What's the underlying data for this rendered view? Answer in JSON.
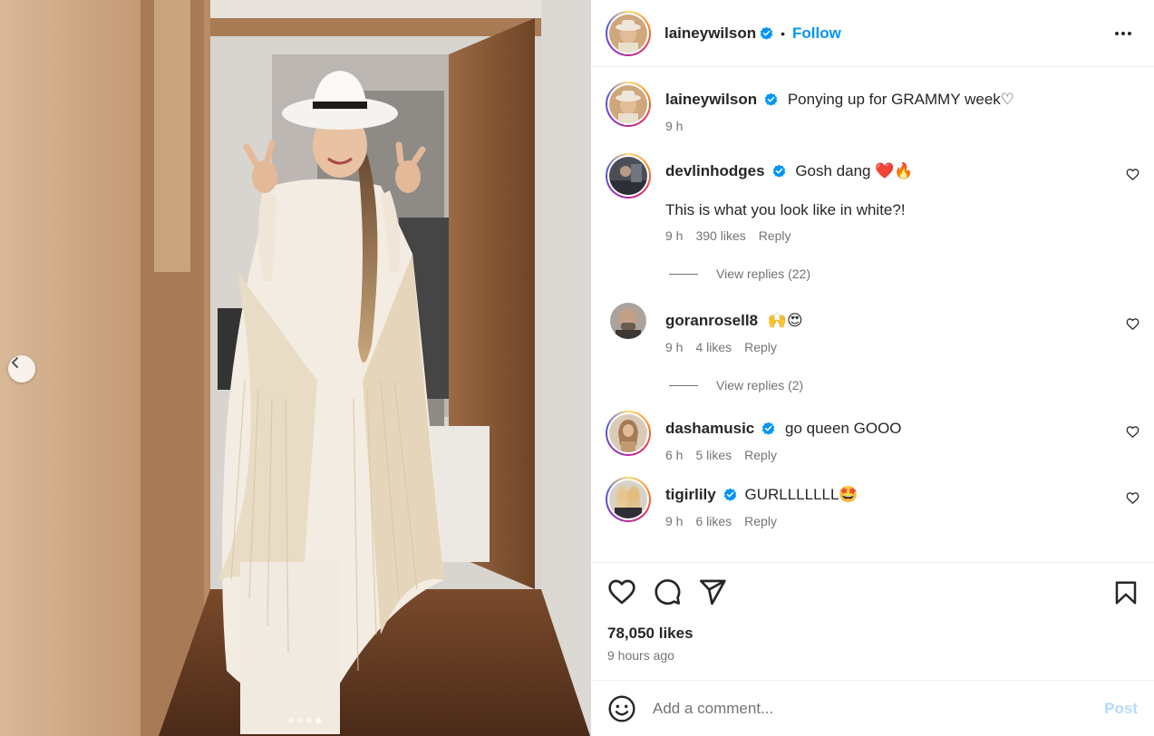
{
  "media": {
    "carousel_dots": 4,
    "active_index": 4
  },
  "post": {
    "author": "laineywilson",
    "follow_label": "Follow",
    "separator": "•",
    "caption_user": "laineywilson",
    "caption": "Ponying up for GRAMMY week♡",
    "caption_time": "9 h"
  },
  "comments": [
    {
      "user": "devlinhodges",
      "verified": true,
      "text": "Gosh dang ❤️🔥",
      "text_line2": "This is what you look like in white?!",
      "time": "9 h",
      "likes": "390 likes",
      "reply_label": "Reply",
      "view_replies": "View replies (22)"
    },
    {
      "user": "goranrosell8",
      "verified": false,
      "text": "🙌😍",
      "time": "9 h",
      "likes": "4 likes",
      "reply_label": "Reply",
      "view_replies": "View replies (2)"
    },
    {
      "user": "dashamusic",
      "verified": true,
      "text": "go queen GOOO",
      "time": "6 h",
      "likes": "5 likes",
      "reply_label": "Reply"
    },
    {
      "user": "tigirlily",
      "verified": true,
      "text": "GURLLLLLLL🤩",
      "time": "9 h",
      "likes": "6 likes",
      "reply_label": "Reply"
    }
  ],
  "footer": {
    "likes": "78,050 likes",
    "time_ago": "9 hours ago",
    "comment_placeholder": "Add a comment...",
    "post_label": "Post"
  },
  "colors": {
    "accent": "#0095f6",
    "verified": "#0095f6",
    "post_disabled": "#b3dbff",
    "muted": "#737373"
  },
  "icons": [
    "more-options-icon",
    "heart-icon",
    "comment-icon",
    "share-icon",
    "bookmark-icon",
    "emoji-icon",
    "chevron-left-icon",
    "verified-badge-icon"
  ]
}
